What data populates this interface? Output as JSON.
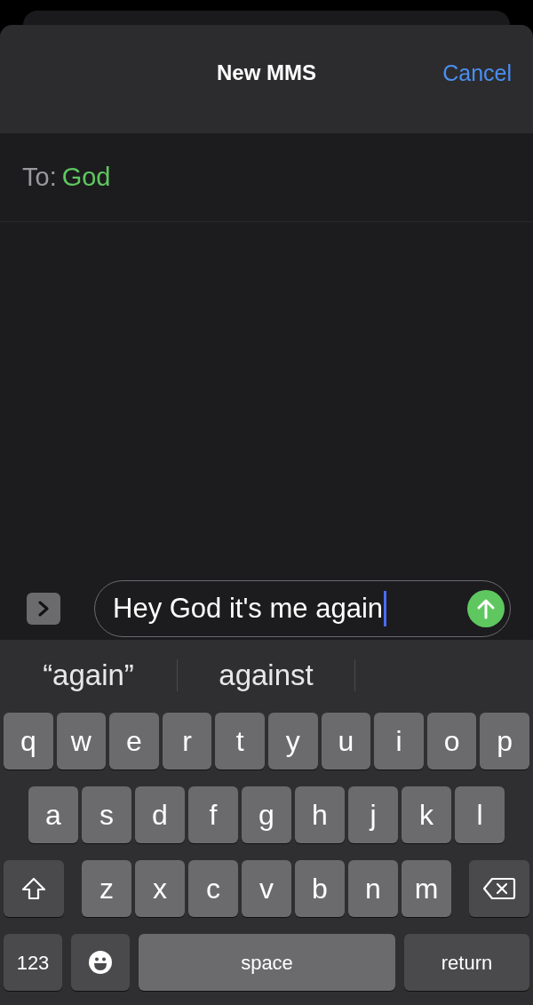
{
  "header": {
    "title": "New MMS",
    "cancel": "Cancel"
  },
  "recipient": {
    "label": "To:",
    "name": "God"
  },
  "composer": {
    "value": "Hey God it's me again",
    "focused": true
  },
  "suggestions": [
    "“again”",
    "against"
  ],
  "keyboard": {
    "letter_rows": [
      {
        "keys": [
          {
            "kind": "letter",
            "label": "q"
          },
          {
            "kind": "letter",
            "label": "w"
          },
          {
            "kind": "letter",
            "label": "e"
          },
          {
            "kind": "letter",
            "label": "r"
          },
          {
            "kind": "letter",
            "label": "t"
          },
          {
            "kind": "letter",
            "label": "y"
          },
          {
            "kind": "letter",
            "label": "u"
          },
          {
            "kind": "letter",
            "label": "i"
          },
          {
            "kind": "letter",
            "label": "o"
          },
          {
            "kind": "letter",
            "label": "p"
          }
        ]
      },
      {
        "keys": [
          {
            "kind": "letter",
            "label": "a"
          },
          {
            "kind": "letter",
            "label": "s"
          },
          {
            "kind": "letter",
            "label": "d"
          },
          {
            "kind": "letter",
            "label": "f"
          },
          {
            "kind": "letter",
            "label": "g"
          },
          {
            "kind": "letter",
            "label": "h"
          },
          {
            "kind": "letter",
            "label": "j"
          },
          {
            "kind": "letter",
            "label": "k"
          },
          {
            "kind": "letter",
            "label": "l"
          }
        ]
      },
      {
        "keys": [
          {
            "kind": "shift"
          },
          {
            "kind": "letter",
            "label": "z"
          },
          {
            "kind": "letter",
            "label": "x"
          },
          {
            "kind": "letter",
            "label": "c"
          },
          {
            "kind": "letter",
            "label": "v"
          },
          {
            "kind": "letter",
            "label": "b"
          },
          {
            "kind": "letter",
            "label": "n"
          },
          {
            "kind": "letter",
            "label": "m"
          },
          {
            "kind": "delete"
          }
        ]
      }
    ],
    "bottom_keys": [
      {
        "kind": "numbers",
        "label": "123"
      },
      {
        "kind": "emoji"
      },
      {
        "kind": "space",
        "label": "space"
      },
      {
        "kind": "return",
        "label": "return"
      }
    ]
  }
}
